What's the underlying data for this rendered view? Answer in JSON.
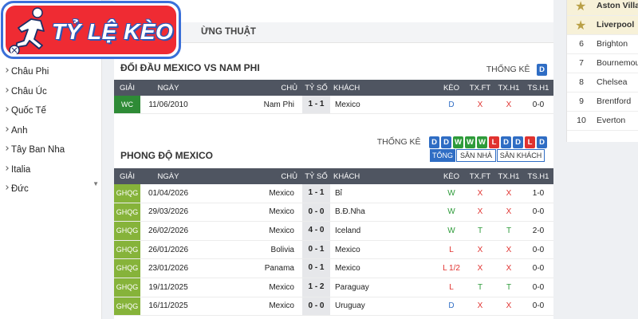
{
  "logo": {
    "text": "TỶ LỆ KÈO"
  },
  "sidebar": {
    "items": [
      {
        "label": "Châu Phi"
      },
      {
        "label": "Châu Úc"
      },
      {
        "label": "Quốc Tế"
      },
      {
        "label": "Anh"
      },
      {
        "label": "Tây Ban Nha"
      },
      {
        "label": "Italia"
      },
      {
        "label": "Đức"
      }
    ]
  },
  "top_band": {
    "label": "ỪNG THUẬT"
  },
  "h2h": {
    "title": "ĐỐI ĐẦU MEXICO VS NAM PHI",
    "stats_label": "THỐNG KÊ",
    "stats_badge": "D",
    "headers": [
      "GIẢI",
      "NGÀY",
      "CHỦ",
      "TỶ SỐ",
      "KHÁCH",
      "KÈO",
      "TX.FT",
      "TX.H1",
      "TS.H1"
    ],
    "rows": [
      {
        "league": "WC",
        "date": "11/06/2010",
        "home": "Nam Phi",
        "score": "1 - 1",
        "away": "Mexico",
        "keo": "D",
        "txft": "X",
        "txh1": "X",
        "tsh1": "0-0"
      }
    ]
  },
  "form": {
    "title": "PHONG ĐỘ MEXICO",
    "stats_label": "THỐNG KÊ",
    "badges": [
      "D",
      "D",
      "W",
      "W",
      "W",
      "L",
      "D",
      "D",
      "L",
      "D"
    ],
    "tabs": [
      {
        "label": "TỔNG",
        "active": true
      },
      {
        "label": "SÂN NHÀ",
        "active": false
      },
      {
        "label": "SÂN KHÁCH",
        "active": false
      }
    ],
    "headers": [
      "GIẢI",
      "NGÀY",
      "CHỦ",
      "TỶ SỐ",
      "KHÁCH",
      "KÈO",
      "TX.FT",
      "TX.H1",
      "TS.H1"
    ],
    "rows": [
      {
        "league": "GHQG",
        "date": "01/04/2026",
        "home": "Mexico",
        "score": "1 - 1",
        "away": "Bỉ",
        "keo": "W",
        "txft": "X",
        "txh1": "X",
        "tsh1": "1-0"
      },
      {
        "league": "GHQG",
        "date": "29/03/2026",
        "home": "Mexico",
        "score": "0 - 0",
        "away": "B.Đ.Nha",
        "keo": "W",
        "txft": "X",
        "txh1": "X",
        "tsh1": "0-0"
      },
      {
        "league": "GHQG",
        "date": "26/02/2026",
        "home": "Mexico",
        "score": "4 - 0",
        "away": "Iceland",
        "keo": "W",
        "txft": "T",
        "txh1": "T",
        "tsh1": "2-0"
      },
      {
        "league": "GHQG",
        "date": "26/01/2026",
        "home": "Bolivia",
        "score": "0 - 1",
        "away": "Mexico",
        "keo": "L",
        "txft": "X",
        "txh1": "X",
        "tsh1": "0-0"
      },
      {
        "league": "GHQG",
        "date": "23/01/2026",
        "home": "Panama",
        "score": "0 - 1",
        "away": "Mexico",
        "keo": "L 1/2",
        "txft": "X",
        "txh1": "X",
        "tsh1": "0-0"
      },
      {
        "league": "GHQG",
        "date": "19/11/2025",
        "home": "Mexico",
        "score": "1 - 2",
        "away": "Paraguay",
        "keo": "L",
        "txft": "T",
        "txh1": "T",
        "tsh1": "0-0"
      },
      {
        "league": "GHQG",
        "date": "16/11/2025",
        "home": "Mexico",
        "score": "0 - 0",
        "away": "Uruguay",
        "keo": "D",
        "txft": "X",
        "txh1": "X",
        "tsh1": "0-0"
      }
    ]
  },
  "standings": [
    {
      "rank": "",
      "team": "Aston Villa",
      "highlight": true
    },
    {
      "rank": "",
      "team": "Liverpool",
      "highlight": true
    },
    {
      "rank": "6",
      "team": "Brighton",
      "highlight": false
    },
    {
      "rank": "7",
      "team": "Bournemouth",
      "highlight": false
    },
    {
      "rank": "8",
      "team": "Chelsea",
      "highlight": false
    },
    {
      "rank": "9",
      "team": "Brentford",
      "highlight": false
    },
    {
      "rank": "10",
      "team": "Everton",
      "highlight": false
    }
  ],
  "colors": {
    "win": "#2e9b3a",
    "draw": "#2f6dc4",
    "loss": "#e0322f",
    "over": "#2e9b3a",
    "under": "#e0322f"
  }
}
